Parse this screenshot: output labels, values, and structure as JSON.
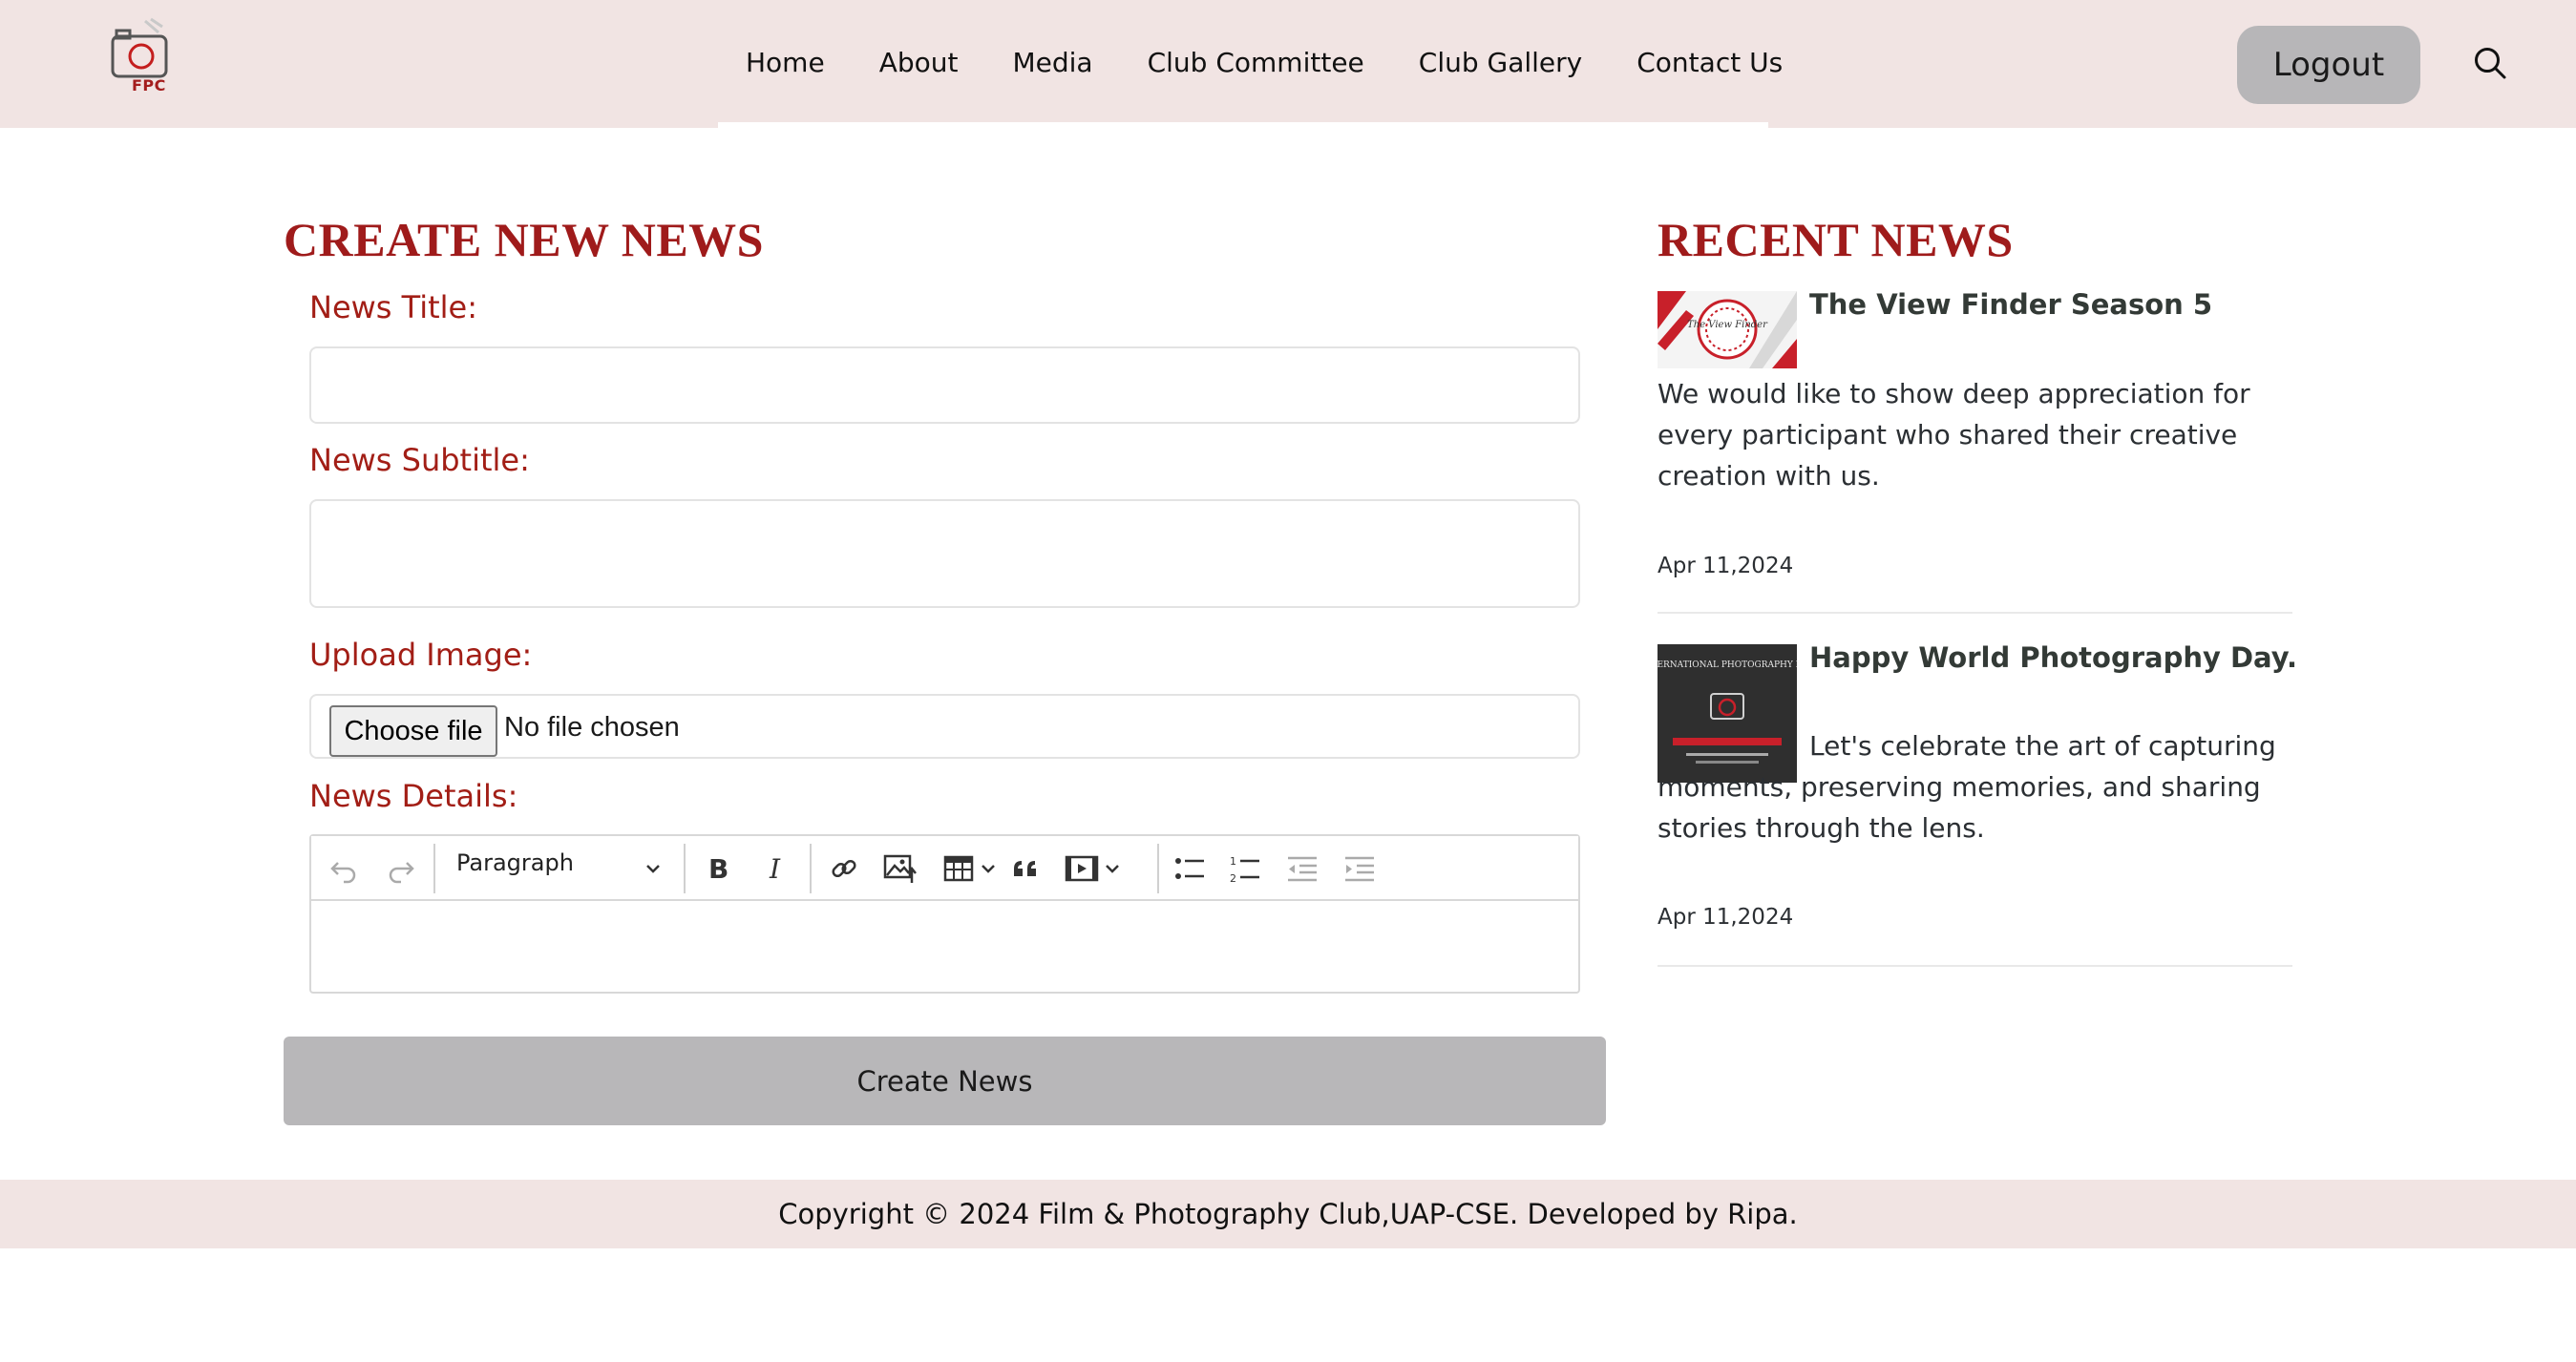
{
  "brand": {
    "logo_text": "FPC",
    "logo_icon": "camera-logo-icon"
  },
  "nav": {
    "links": [
      "Home",
      "About",
      "Media",
      "Club Committee",
      "Club Gallery",
      "Contact Us"
    ],
    "logout_label": "Logout",
    "search_icon": "search-icon"
  },
  "form": {
    "heading": "CREATE NEW NEWS",
    "title_label": "News Title:",
    "title_value": "",
    "subtitle_label": "News Subtitle:",
    "subtitle_value": "",
    "image_label": "Upload Image:",
    "file_button": "Choose file",
    "file_status": "No file chosen",
    "details_label": "News Details:",
    "editor": {
      "block_format": "Paragraph",
      "tools": [
        "undo-icon",
        "redo-icon",
        "bold-icon",
        "italic-icon",
        "link-icon",
        "insert-image-icon",
        "table-icon",
        "blockquote-icon",
        "media-embed-icon",
        "bulleted-list-icon",
        "numbered-list-icon",
        "outdent-icon",
        "indent-icon"
      ],
      "content": ""
    },
    "submit_label": "Create News"
  },
  "recent": {
    "heading": "RECENT NEWS",
    "items": [
      {
        "title": "The View Finder Season 5",
        "text": "We would like to show deep appreciation for every participant who shared their creative creation with us.",
        "date": "Apr 11,2024",
        "thumb_text": "The View Finder"
      },
      {
        "title": "Happy World Photography Day.",
        "text": "Let's celebrate the art of capturing moments, preserving memories, and sharing stories through the lens.",
        "date": "Apr 11,2024",
        "thumb_text": "INTERNATIONAL PHOTOGRAPHY DAY"
      }
    ]
  },
  "colors": {
    "accent": "#9f1b1b",
    "nav_bg": "#f1e4e3",
    "button_gray": "#b8b7b9"
  },
  "footer": {
    "text": "Copyright © 2024 Film & Photography Club,UAP-CSE. Developed by Ripa."
  }
}
